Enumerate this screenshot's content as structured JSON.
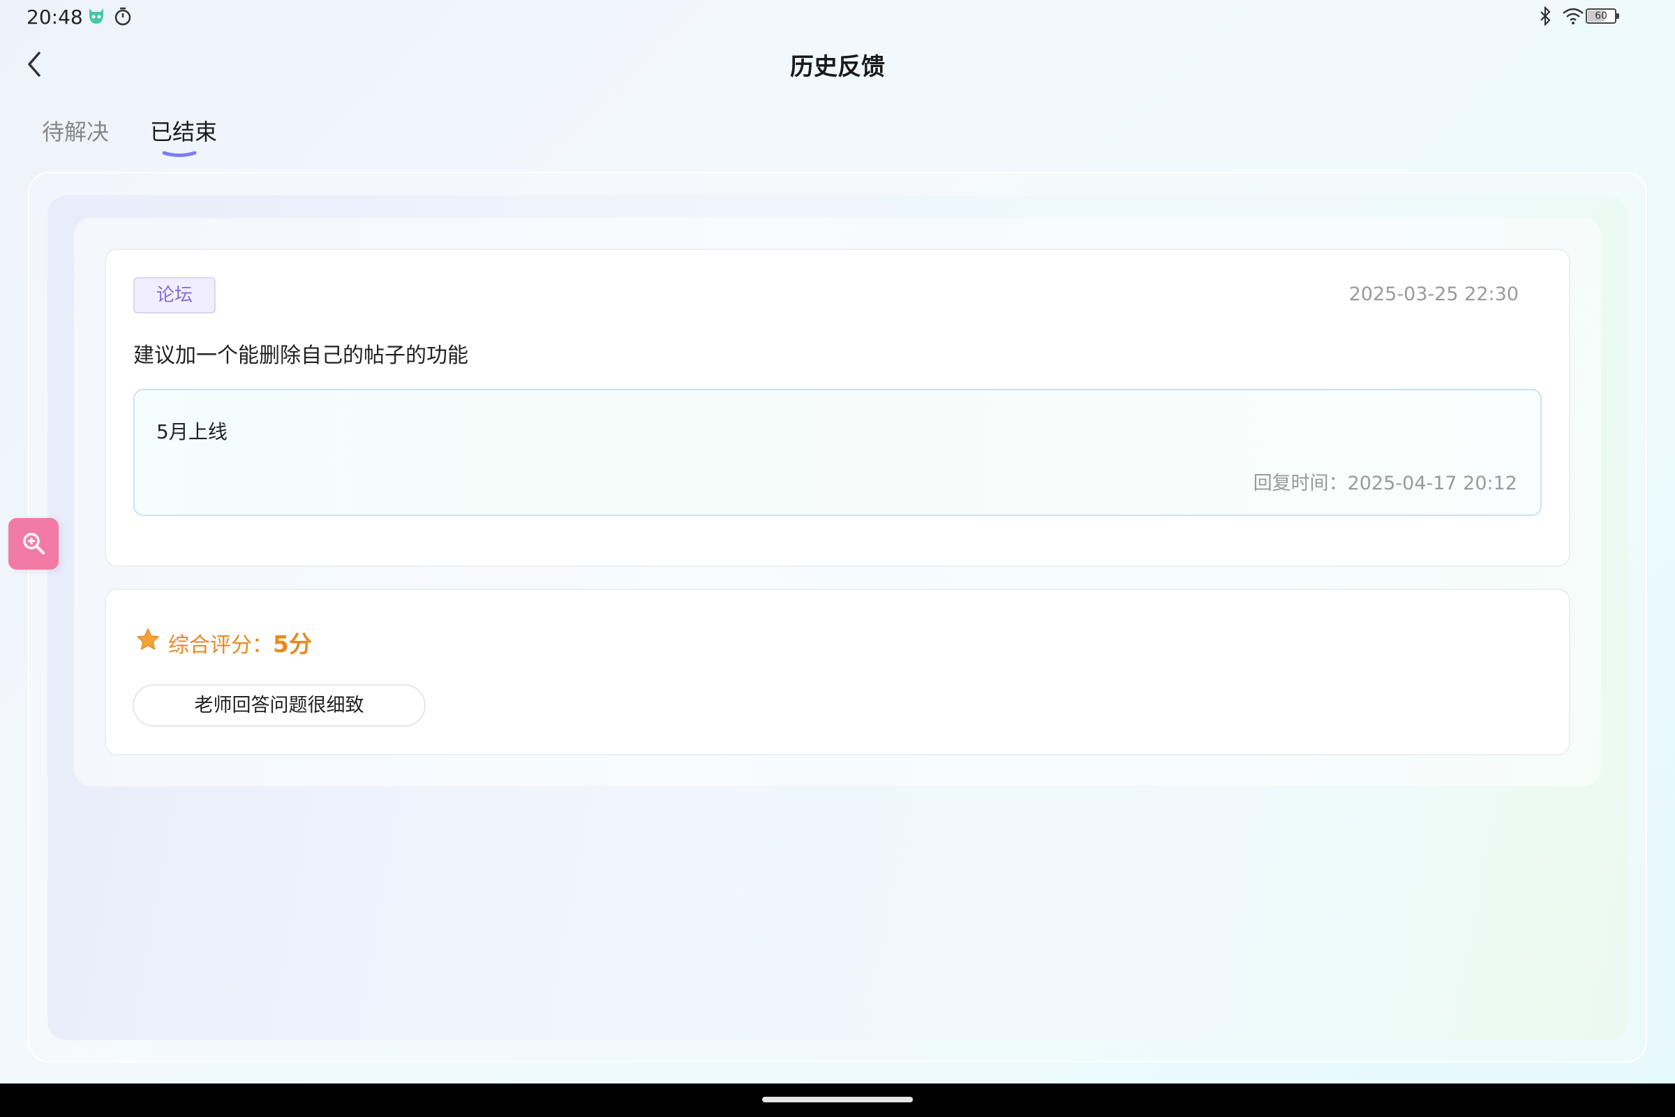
{
  "status_bar": {
    "time": "20:48",
    "battery_level": "60",
    "icons": [
      "robot-icon",
      "timer-icon",
      "bluetooth-icon",
      "wifi-icon",
      "battery-icon"
    ]
  },
  "header": {
    "title": "历史反馈",
    "back_icon": "chevron-left-icon"
  },
  "tabs": [
    {
      "label": "待解决",
      "active": false
    },
    {
      "label": "已结束",
      "active": true
    }
  ],
  "feedback": {
    "tag": "论坛",
    "submitted_at": "2025-03-25 22:30",
    "content": "建议加一个能删除自己的帖子的功能",
    "reply": {
      "text": "5月上线",
      "time": "回复时间：2025-04-17 20:12"
    }
  },
  "rating": {
    "label": "综合评分：",
    "value": "5分",
    "comment": "老师回答问题很细致"
  },
  "floating_button": {
    "icon": "zoom-in-icon"
  },
  "colors": {
    "accent_orange": "#e88a1e",
    "tag_purple": "#7e6fd6",
    "float_pink": "#f27ba5",
    "tab_underline": "#7d7ef0"
  }
}
